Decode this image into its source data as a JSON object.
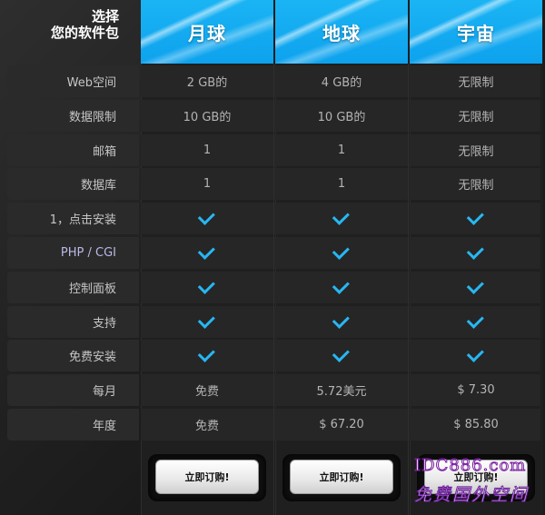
{
  "header": {
    "corner_line1": "选择",
    "corner_line2": "您的软件包"
  },
  "plans": [
    {
      "name": "月球",
      "button": "立即订购!"
    },
    {
      "name": "地球",
      "button": "立即订购!"
    },
    {
      "name": "宇宙",
      "button": "立即订购!"
    }
  ],
  "rows": [
    {
      "label": "Web空间",
      "values": [
        "2 GB的",
        "4 GB的",
        "无限制"
      ]
    },
    {
      "label": "数据限制",
      "values": [
        "10 GB的",
        "10 GB的",
        "无限制"
      ]
    },
    {
      "label": "邮箱",
      "values": [
        "1",
        "1",
        "无限制"
      ]
    },
    {
      "label": "数据库",
      "values": [
        "1",
        "1",
        "无限制"
      ]
    },
    {
      "label": "1，点击安装",
      "values": [
        "check",
        "check",
        "check"
      ]
    },
    {
      "label": "PHP / CGI",
      "values": [
        "check",
        "check",
        "check"
      ]
    },
    {
      "label": "控制面板",
      "values": [
        "check",
        "check",
        "check"
      ]
    },
    {
      "label": "支持",
      "values": [
        "check",
        "check",
        "check"
      ]
    },
    {
      "label": "免费安装",
      "values": [
        "check",
        "check",
        "check"
      ]
    },
    {
      "label": "每月",
      "values": [
        "免费",
        "5.72美元",
        "$ 7.30"
      ]
    },
    {
      "label": "年度",
      "values": [
        "免费",
        "$ 67.20",
        "$ 85.80"
      ]
    }
  ],
  "watermark": {
    "line1": "IDC886.com",
    "line2": "免费国外空间"
  },
  "colors": {
    "accent": "#1ab4f4",
    "check": "#27b7f2",
    "background": "#1b1b1b"
  },
  "icons": {
    "check": "check-icon"
  }
}
